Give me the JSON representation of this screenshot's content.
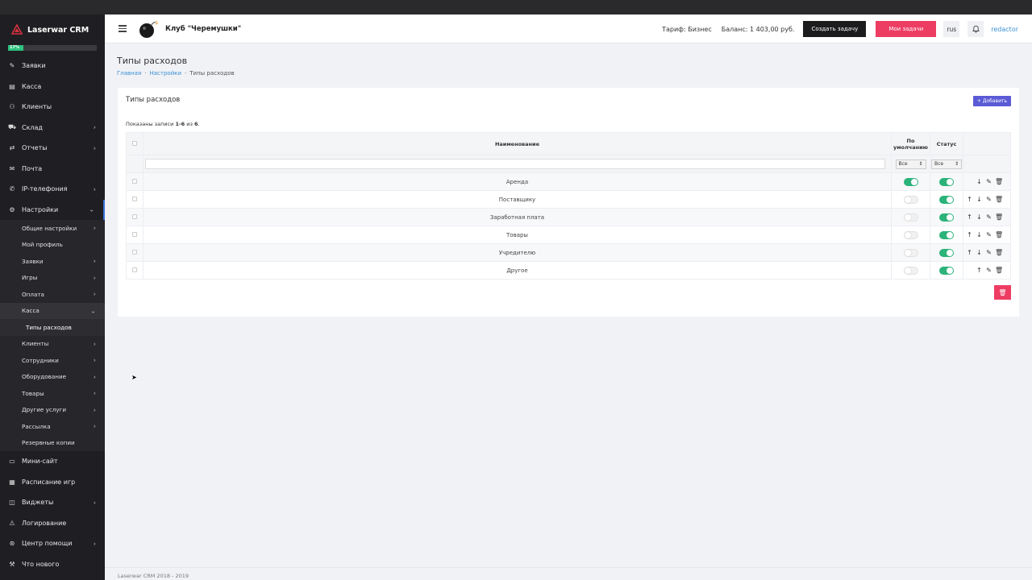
{
  "app": {
    "name": "Laserwar CRM",
    "progress_label": "17%",
    "progress_value": 0.17
  },
  "sidebar": {
    "items": [
      {
        "label": "Заявки",
        "icon": "edit-icon",
        "chevron": false
      },
      {
        "label": "Касса",
        "icon": "wallet-icon",
        "chevron": false
      },
      {
        "label": "Клиенты",
        "icon": "users-icon",
        "chevron": false
      },
      {
        "label": "Склад",
        "icon": "cart-icon",
        "chevron": true
      },
      {
        "label": "Отчеты",
        "icon": "shuffle-icon",
        "chevron": true
      },
      {
        "label": "Почта",
        "icon": "mail-icon",
        "chevron": false
      },
      {
        "label": "IP-телефония",
        "icon": "phone-icon",
        "chevron": true
      },
      {
        "label": "Настройки",
        "icon": "settings-icon",
        "chevron": "down"
      }
    ],
    "settings_sub": [
      {
        "label": "Общие настройки",
        "chevron": true
      },
      {
        "label": "Мой профиль",
        "chevron": false
      },
      {
        "label": "Заявки",
        "chevron": true
      },
      {
        "label": "Игры",
        "chevron": true
      },
      {
        "label": "Оплата",
        "chevron": true
      },
      {
        "label": "Касса",
        "chevron": "down"
      }
    ],
    "kassa_sub": [
      {
        "label": "Типы расходов"
      }
    ],
    "settings_sub2": [
      {
        "label": "Клиенты",
        "chevron": true
      },
      {
        "label": "Сотрудники",
        "chevron": true
      },
      {
        "label": "Оборудование",
        "chevron": true
      },
      {
        "label": "Товары",
        "chevron": true
      },
      {
        "label": "Другие услуги",
        "chevron": true
      },
      {
        "label": "Рассылка",
        "chevron": true
      },
      {
        "label": "Резервные копии",
        "chevron": false
      }
    ],
    "items2": [
      {
        "label": "Мини-сайт",
        "icon": "monitor-icon",
        "chevron": false
      },
      {
        "label": "Расписание игр",
        "icon": "calendar-icon",
        "chevron": false
      },
      {
        "label": "Виджеты",
        "icon": "widget-icon",
        "chevron": true
      },
      {
        "label": "Логирование",
        "icon": "warning-icon",
        "chevron": false
      },
      {
        "label": "Центр помощи",
        "icon": "help-icon",
        "chevron": true
      },
      {
        "label": "Что нового",
        "icon": "wrench-icon",
        "chevron": false
      }
    ]
  },
  "header": {
    "club": "Клуб \"Черемушки\"",
    "tariff": "Тариф: Бизнес",
    "balance": "Баланс: 1 403,00 руб.",
    "create_task": "Создать задачу",
    "my_tasks": "Мои задачи",
    "lang": "rus",
    "user": "redactor"
  },
  "page": {
    "title": "Типы расходов",
    "breadcrumb": [
      "Главная",
      "Настройки",
      "Типы расходов"
    ]
  },
  "card": {
    "title": "Типы расходов",
    "add_label": "+ Добавить",
    "shown_prefix": "Показаны записи ",
    "shown_range": "1-6",
    "shown_mid": " из ",
    "shown_total": "6",
    "shown_suffix": ".",
    "columns": {
      "name": "Наименование",
      "default": "По умолчанию",
      "status": "Статус"
    },
    "filter": {
      "default": "Все",
      "status": "Все"
    },
    "rows": [
      {
        "name": "Аренда",
        "default": true,
        "status": true,
        "actions": [
          "down",
          "edit",
          "delete"
        ]
      },
      {
        "name": "Поставщику",
        "default": false,
        "status": true,
        "actions": [
          "up",
          "down",
          "edit",
          "delete"
        ]
      },
      {
        "name": "Заработная плата",
        "default": false,
        "status": true,
        "actions": [
          "up",
          "down",
          "edit",
          "delete"
        ]
      },
      {
        "name": "Товары",
        "default": false,
        "status": true,
        "actions": [
          "up",
          "down",
          "edit",
          "delete"
        ]
      },
      {
        "name": "Учредителю",
        "default": false,
        "status": true,
        "actions": [
          "up",
          "down",
          "edit",
          "delete"
        ]
      },
      {
        "name": "Другое",
        "default": false,
        "status": true,
        "actions": [
          "up",
          "edit",
          "delete"
        ]
      }
    ]
  },
  "footer": {
    "text": "Laserwar CRM 2018 - 2019"
  }
}
